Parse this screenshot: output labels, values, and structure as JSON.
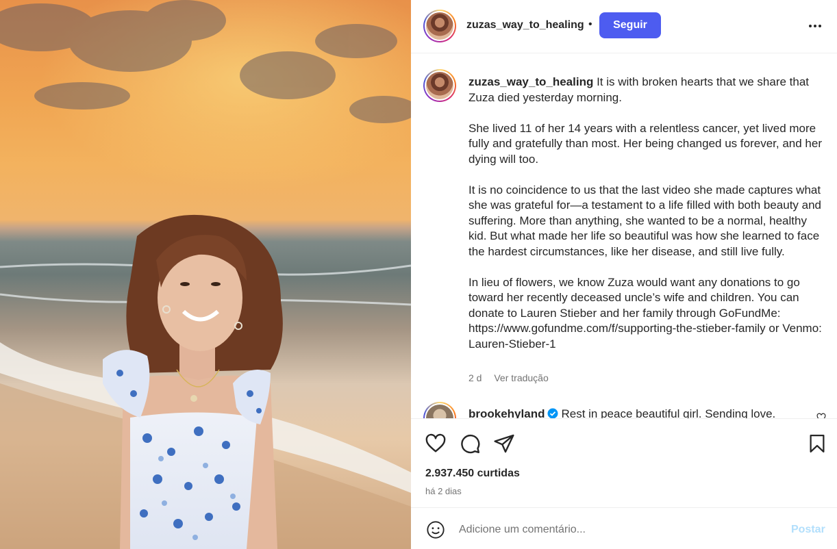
{
  "post": {
    "username": "zuzas_way_to_healing",
    "separator": "•",
    "follow_label": "Seguir",
    "caption": {
      "username": "zuzas_way_to_healing",
      "paragraph_1": "It is with broken hearts that we share that Zuza died yesterday morning.",
      "paragraph_2": "She lived 11 of her 14 years with a relentless cancer, yet lived more fully and gratefully than most. Her being changed us forever, and her dying will too.",
      "paragraph_3": "It is no coincidence to us that the last video she made captures what she was grateful for—a testament to a life filled with both beauty and suffering. More than anything, she wanted to be a normal, healthy kid. But what made her life so beautiful was how she learned to face the hardest circumstances, like her disease, and still live fully.",
      "paragraph_4": "In lieu of flowers, we know Zuza would want any donations to go toward her recently deceased uncle’s wife and children. You can donate to Lauren Stieber and her family through GoFundMe: https://www.gofundme.com/f/supporting-the-stieber-family or Venmo: Lauren-Stieber-1",
      "age": "2 d",
      "translate_label": "Ver tradução"
    },
    "comment": {
      "username": "brookehyland",
      "text": "Rest in peace beautiful girl. Sending love."
    },
    "likes_label": "2.937.450 curtidas",
    "date_label": "há 2 dias",
    "comment_placeholder": "Adicione um comentário...",
    "post_label": "Postar"
  },
  "icons": {
    "more": "more-horizontal-icon",
    "like": "heart-icon",
    "comment": "comment-icon",
    "share": "share-icon",
    "save": "bookmark-icon",
    "emoji": "emoji-icon",
    "verified": "verified-badge-icon"
  },
  "colors": {
    "follow_button": "#4d5cf0",
    "post_button_disabled": "#b2dffc",
    "verified": "#0095f6",
    "secondary_text": "#737373"
  }
}
